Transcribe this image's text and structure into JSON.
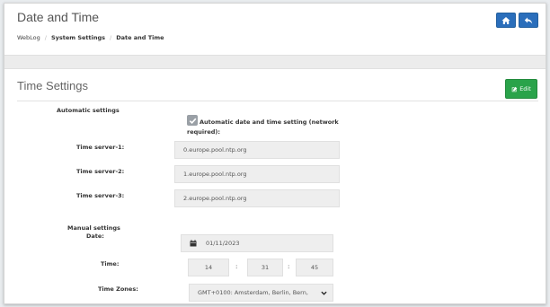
{
  "header": {
    "title": "Date and Time",
    "breadcrumb": [
      "WebLog",
      "System Settings",
      "Date and Time"
    ],
    "buttons": [
      {
        "icon": "home-icon"
      },
      {
        "icon": "back-arrow-icon"
      }
    ]
  },
  "section": {
    "title": "Time Settings",
    "edit_label": "Edit",
    "edit_icon": "edit-icon"
  },
  "automatic": {
    "heading": "Automatic settings",
    "checkbox_checked": true,
    "checkbox_label": "Automatic date and time setting (network",
    "checkbox_label_cont": "required):",
    "servers": [
      {
        "label": "Time server-1:",
        "value": "0.europe.pool.ntp.org"
      },
      {
        "label": "Time server-2:",
        "value": "1.europe.pool.ntp.org"
      },
      {
        "label": "Time server-3:",
        "value": "2.europe.pool.ntp.org"
      }
    ]
  },
  "manual": {
    "heading": "Manual settings",
    "date_label": "Date:",
    "date_value": "01/11/2023",
    "time_label": "Time:",
    "hour": "14",
    "minute": "31",
    "second": "45",
    "timezone_label": "Time Zones:",
    "timezone_value": "GMT+0100: Amsterdam, Berlin, Bern,"
  },
  "colors": {
    "primary": "#2a6ebb",
    "success": "#2aa34a",
    "field_bg": "#eeeeee"
  }
}
